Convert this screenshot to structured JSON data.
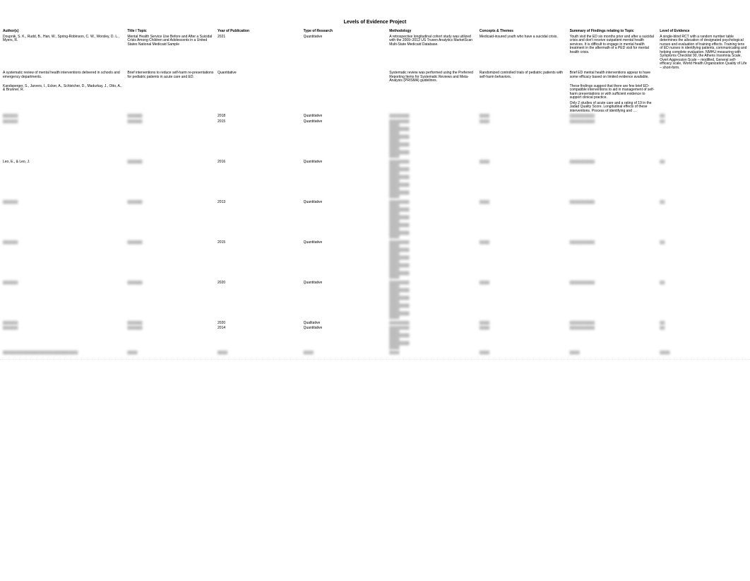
{
  "page_title": "Levels of Evidence Project",
  "columns": [
    "Author(s)",
    "Title / Topic",
    "Year of Publication",
    "Type of Research",
    "Methodology",
    "Concepts & Themes",
    "Summary of Findings relating to Topic",
    "Level of Evidence"
  ],
  "rows": [
    {
      "author": "Doupnik, S. K., Rudd, B., Han, W., Spring-Robinson, C. W., Worsley, D. L., Myers, R.",
      "title": "Mental Health Service Use Before and After a Suicidal Crisis Among Children and Adolescents in a United States National Medicaid Sample",
      "year": "2021",
      "type": "Quantitative",
      "method": "A retrospective longitudinal cohort study was utilized with the 2009–2012 US Truven Analytics MarketScan Multi-State Medicaid Database.",
      "concept": "Medicaid-insured youth who have a suicidal crisis.",
      "summary": "Youth visit the ED six months prior and after a suicidal crisis and don't receive outpatient mental health services. It is difficult to engage in mental health treatment in the aftermath of a PED visit for mental health crisis.",
      "level": "A single-blind RCT with a random number table determines the allocation of designated psychological nurses and evaluation of training effects. Training tens of ED nurses in identifying patients, communicating and helping complete evaluation. NMHU measuring with Symptoms Checklist 90, the Athens Insomnia Scale, Overt Aggression Scale – modified, General self-efficacy scale, World Health Organization Quality of Life – short-form."
    },
    {
      "author": "A systematic review of mental health interventions delivered in schools and emergency departments.",
      "title": "Brief interventions to reduce self-harm re-presentations for pediatric patients in acute care and ED.",
      "year": "Quantitative",
      "type": "",
      "method": "Systematic review was performed using the Preferred Reporting Items for Systematic Reviews and Meta-Analysis (PRISMA) guidelines.",
      "concept": "Randomized controlled trials of pediatric patients with self-harm behaviors.",
      "summary": "Brief ED mental health interventions appear to have some efficacy based on limited evidence available.",
      "level": ""
    },
    {
      "author": "Kandsperger, S., Jarvers, I., Ecker, A., Schleicher, D., Madurkay, J., Otto, A., & Brunner, R.",
      "title": "",
      "year": "",
      "type": "",
      "method": "",
      "concept": "",
      "summary": "These findings suggest that there are few brief ED-compatible interventions to aid in management of self-harm presentations or with sufficient evidence to support clinical practice.",
      "level": ""
    },
    {
      "author": "",
      "title": "",
      "year": "",
      "type": "",
      "method": "",
      "concept": "",
      "summary": "Only 2 studies of acute care and a rating of 19 in the Jadad Quality Score. Longitudinal effects of these interventions. Process of identifying and …",
      "level": ""
    }
  ],
  "blurred_rows": [
    {
      "year": "2018",
      "type": "Quantitative"
    },
    {
      "year": "2015",
      "type": "Quantitative"
    },
    {
      "year": "2016",
      "type": "Quantitative",
      "author": "Leo, E., & Leo, J."
    },
    {
      "year": "2013",
      "type": "Quantitative"
    },
    {
      "year": "2015",
      "type": "Quantitative"
    },
    {
      "year": "2020",
      "type": "Quantitative"
    },
    {
      "year": "2020",
      "type": "Qualitative"
    },
    {
      "year": "2014",
      "type": "Quantitative"
    }
  ]
}
